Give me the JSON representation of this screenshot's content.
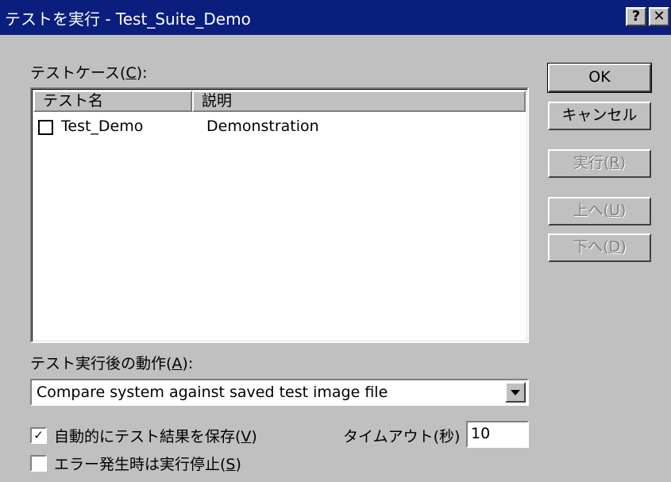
{
  "window": {
    "title": "テストを実行 - Test_Suite_Demo",
    "help_button": "?",
    "close_button": "✕"
  },
  "test_cases": {
    "label": "テストケース(",
    "label_key": "C",
    "label_end": "):",
    "columns": [
      "テスト名",
      "説明"
    ],
    "rows": [
      {
        "name": "Test_Demo",
        "description": "Demonstration",
        "checked": false
      }
    ]
  },
  "after_action": {
    "label": "テスト実行後の動作(",
    "label_key": "A",
    "label_end": "):",
    "selected": "Compare system against saved test image file"
  },
  "options": {
    "auto_save": {
      "label": "自動的にテスト結果を保存(",
      "key": "V",
      "end": ")",
      "checked": true,
      "mark": "✓"
    },
    "stop_on_error": {
      "label": "エラー発生時は実行停止(",
      "key": "S",
      "end": ")",
      "checked": false,
      "mark": ""
    }
  },
  "timeout": {
    "label": "タイムアウト(秒)",
    "value": "10"
  },
  "buttons": {
    "ok": "OK",
    "cancel": "キャンセル",
    "run": {
      "label": "実行(",
      "key": "R",
      "end": ")"
    },
    "up": {
      "label": "上へ(",
      "key": "U",
      "end": ")"
    },
    "down": {
      "label": "下へ(",
      "key": "D",
      "end": ")"
    }
  },
  "colors": {
    "titlebar": "#0a1e7d",
    "face": "#c0c0c0",
    "disabled_text": "#808080"
  }
}
